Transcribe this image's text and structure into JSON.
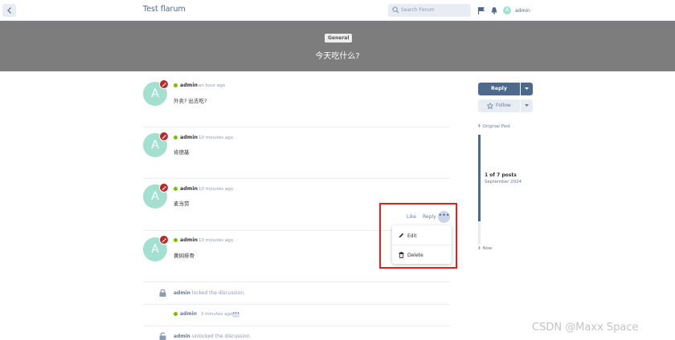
{
  "header": {
    "site_title": "Test flarum",
    "search_placeholder": "Search Forum",
    "avatar_letter": "A",
    "username": "admin"
  },
  "hero": {
    "tag": "General",
    "title": "今天吃什么?"
  },
  "posts": [
    {
      "avatar_letter": "A",
      "author": "admin",
      "time": "an hour ago",
      "body": "外卖? 出去吃?"
    },
    {
      "avatar_letter": "A",
      "author": "admin",
      "time": "10 minutes ago",
      "body": "肯德基"
    },
    {
      "avatar_letter": "A",
      "author": "admin",
      "time": "10 minutes ago",
      "body": "麦当劳"
    },
    {
      "avatar_letter": "A",
      "author": "admin",
      "time": "10 minutes ago",
      "body": "黄焖排骨"
    }
  ],
  "post_actions": {
    "like": "Like",
    "reply": "Reply",
    "more": "•••"
  },
  "dropdown": {
    "edit": "Edit",
    "delete": "Delete"
  },
  "events": [
    {
      "user": "admin",
      "text": "locked the discussion."
    },
    {
      "user": "admin",
      "time": "3 minutes ago",
      "more": "•••"
    },
    {
      "user": "admin",
      "text": "unlocked the discussion."
    }
  ],
  "sidebar": {
    "reply": "Reply",
    "follow": "Follow",
    "original_post": "Original Post",
    "count": "1 of 7 posts",
    "date": "September 2024",
    "now": "Now"
  },
  "colors": {
    "primary": "#4d698e",
    "avatar": "#a3e0d0",
    "hero": "#7d7d7d",
    "badge": "#b72a2a",
    "online": "#7fba00",
    "highlight": "#e02020"
  },
  "watermark": "CSDN @Maxx Space"
}
